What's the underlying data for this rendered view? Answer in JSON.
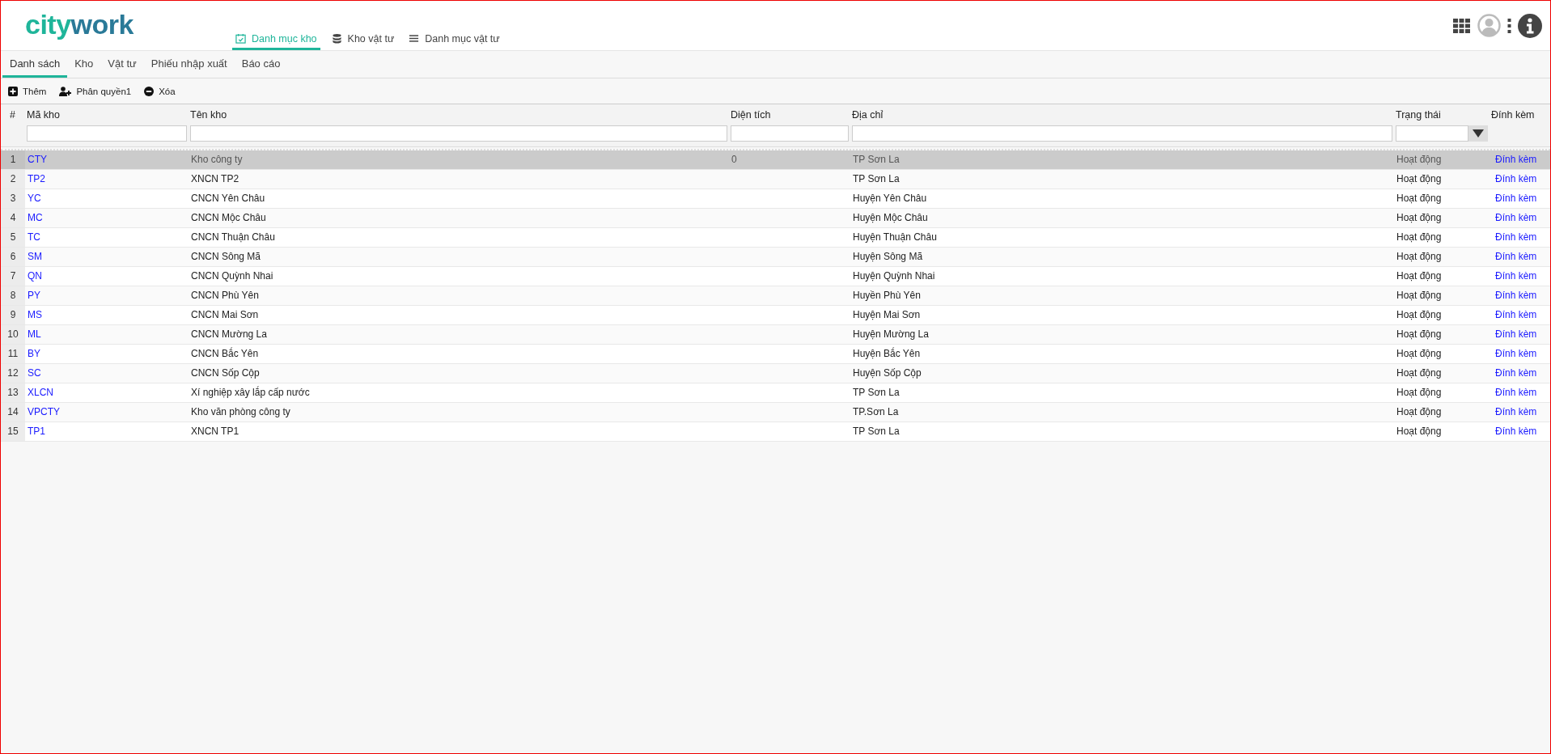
{
  "logo": {
    "first": "city",
    "second": "work"
  },
  "main_tabs": [
    {
      "label": "Danh mục kho",
      "kind": "calendar",
      "selected": true
    },
    {
      "label": "Kho vật tư",
      "kind": "database",
      "selected": false
    },
    {
      "label": "Danh mục vật tư",
      "kind": "list",
      "selected": false
    }
  ],
  "sub_tabs": [
    {
      "label": "Danh sách",
      "selected": true
    },
    {
      "label": "Kho",
      "selected": false
    },
    {
      "label": "Vật tư",
      "selected": false
    },
    {
      "label": "Phiếu nhập xuất",
      "selected": false
    },
    {
      "label": "Báo cáo",
      "selected": false
    }
  ],
  "toolbar": [
    {
      "label": "Thêm",
      "kind": "add"
    },
    {
      "label": "Phân quyền1",
      "kind": "permission"
    },
    {
      "label": "Xóa",
      "kind": "delete"
    }
  ],
  "table": {
    "columns": [
      {
        "label": "#",
        "kind": "plain"
      },
      {
        "label": "Mã kho",
        "kind": "text"
      },
      {
        "label": "Tên kho",
        "kind": "text"
      },
      {
        "label": "Diện tích",
        "kind": "text"
      },
      {
        "label": "Địa chỉ",
        "kind": "text"
      },
      {
        "label": "Trạng thái",
        "kind": "select"
      },
      {
        "label": "Đính kèm",
        "kind": "plain"
      }
    ],
    "rows": [
      {
        "index": "1",
        "code": "CTY",
        "name": "Kho công ty",
        "area": "0",
        "address": "TP Sơn La",
        "status": "Hoạt động",
        "attachment": "Đính kèm",
        "selected": true
      },
      {
        "index": "2",
        "code": "TP2",
        "name": "XNCN TP2",
        "address": "TP Sơn La",
        "status": "Hoạt động",
        "attachment": "Đính kèm",
        "selected": false
      },
      {
        "index": "3",
        "code": "YC",
        "name": "CNCN Yên Châu",
        "address": "Huyện Yên Châu",
        "status": "Hoạt động",
        "attachment": "Đính kèm",
        "selected": false
      },
      {
        "index": "4",
        "code": "MC",
        "name": "CNCN Mộc Châu",
        "address": "Huyện Mộc Châu",
        "status": "Hoạt động",
        "attachment": "Đính kèm",
        "selected": false
      },
      {
        "index": "5",
        "code": "TC",
        "name": "CNCN Thuận Châu",
        "address": "Huyện Thuận Châu",
        "status": "Hoạt động",
        "attachment": "Đính kèm",
        "selected": false
      },
      {
        "index": "6",
        "code": "SM",
        "name": "CNCN Sông Mã",
        "address": "Huyện Sông Mã",
        "status": "Hoạt động",
        "attachment": "Đính kèm",
        "selected": false
      },
      {
        "index": "7",
        "code": "QN",
        "name": "CNCN Quỳnh Nhai",
        "address": "Huyện Quỳnh Nhai",
        "status": "Hoạt động",
        "attachment": "Đính kèm",
        "selected": false
      },
      {
        "index": "8",
        "code": "PY",
        "name": "CNCN Phù Yên",
        "address": "Huyền Phù Yên",
        "status": "Hoạt động",
        "attachment": "Đính kèm",
        "selected": false
      },
      {
        "index": "9",
        "code": "MS",
        "name": "CNCN Mai Sơn",
        "address": "Huyện Mai Sơn",
        "status": "Hoạt động",
        "attachment": "Đính kèm",
        "selected": false
      },
      {
        "index": "10",
        "code": "ML",
        "name": "CNCN Mường La",
        "address": "Huyện Mường La",
        "status": "Hoạt động",
        "attachment": "Đính kèm",
        "selected": false
      },
      {
        "index": "11",
        "code": "BY",
        "name": "CNCN Bắc Yên",
        "address": "Huyện Bắc Yên",
        "status": "Hoạt động",
        "attachment": "Đính kèm",
        "selected": false
      },
      {
        "index": "12",
        "code": "SC",
        "name": "CNCN Sốp Cộp",
        "address": "Huyện Sốp Cộp",
        "status": "Hoạt động",
        "attachment": "Đính kèm",
        "selected": false
      },
      {
        "index": "13",
        "code": "XLCN",
        "name": "Xí nghiệp xây lắp cấp nước",
        "address": "TP Sơn La",
        "status": "Hoạt động",
        "attachment": "Đính kèm",
        "selected": false
      },
      {
        "index": "14",
        "code": "VPCTY",
        "name": "Kho văn phòng công ty",
        "address": "TP.Sơn La",
        "status": "Hoạt động",
        "attachment": "Đính kèm",
        "selected": false
      },
      {
        "index": "15",
        "code": "TP1",
        "name": "XNCN TP1",
        "address": "TP Sơn La",
        "status": "Hoạt động",
        "attachment": "Đính kèm",
        "selected": false
      }
    ]
  }
}
